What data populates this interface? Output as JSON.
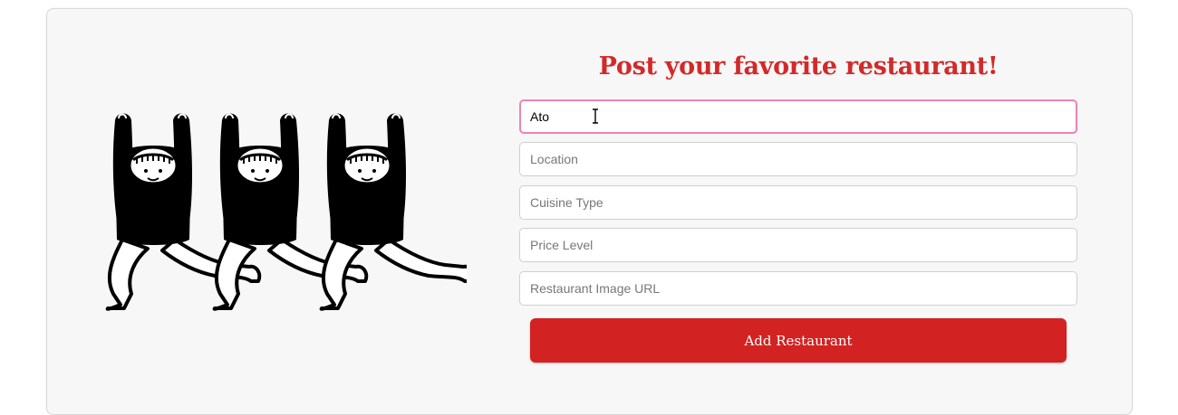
{
  "form": {
    "title": "Post your favorite restaurant!",
    "name_value": "Ato",
    "fields": [
      {
        "placeholder": "Location",
        "value": ""
      },
      {
        "placeholder": "Cuisine Type",
        "value": ""
      },
      {
        "placeholder": "Price Level",
        "value": ""
      },
      {
        "placeholder": "Restaurant Image URL",
        "value": ""
      }
    ],
    "submit_label": "Add Restaurant"
  },
  "colors": {
    "accent": "#d32222",
    "focus_border": "#ef83b0",
    "card_bg": "#f7f7f7"
  },
  "icons": {
    "illustration": "three-dancing-figures-illustration",
    "cursor": "text-cursor-icon"
  }
}
